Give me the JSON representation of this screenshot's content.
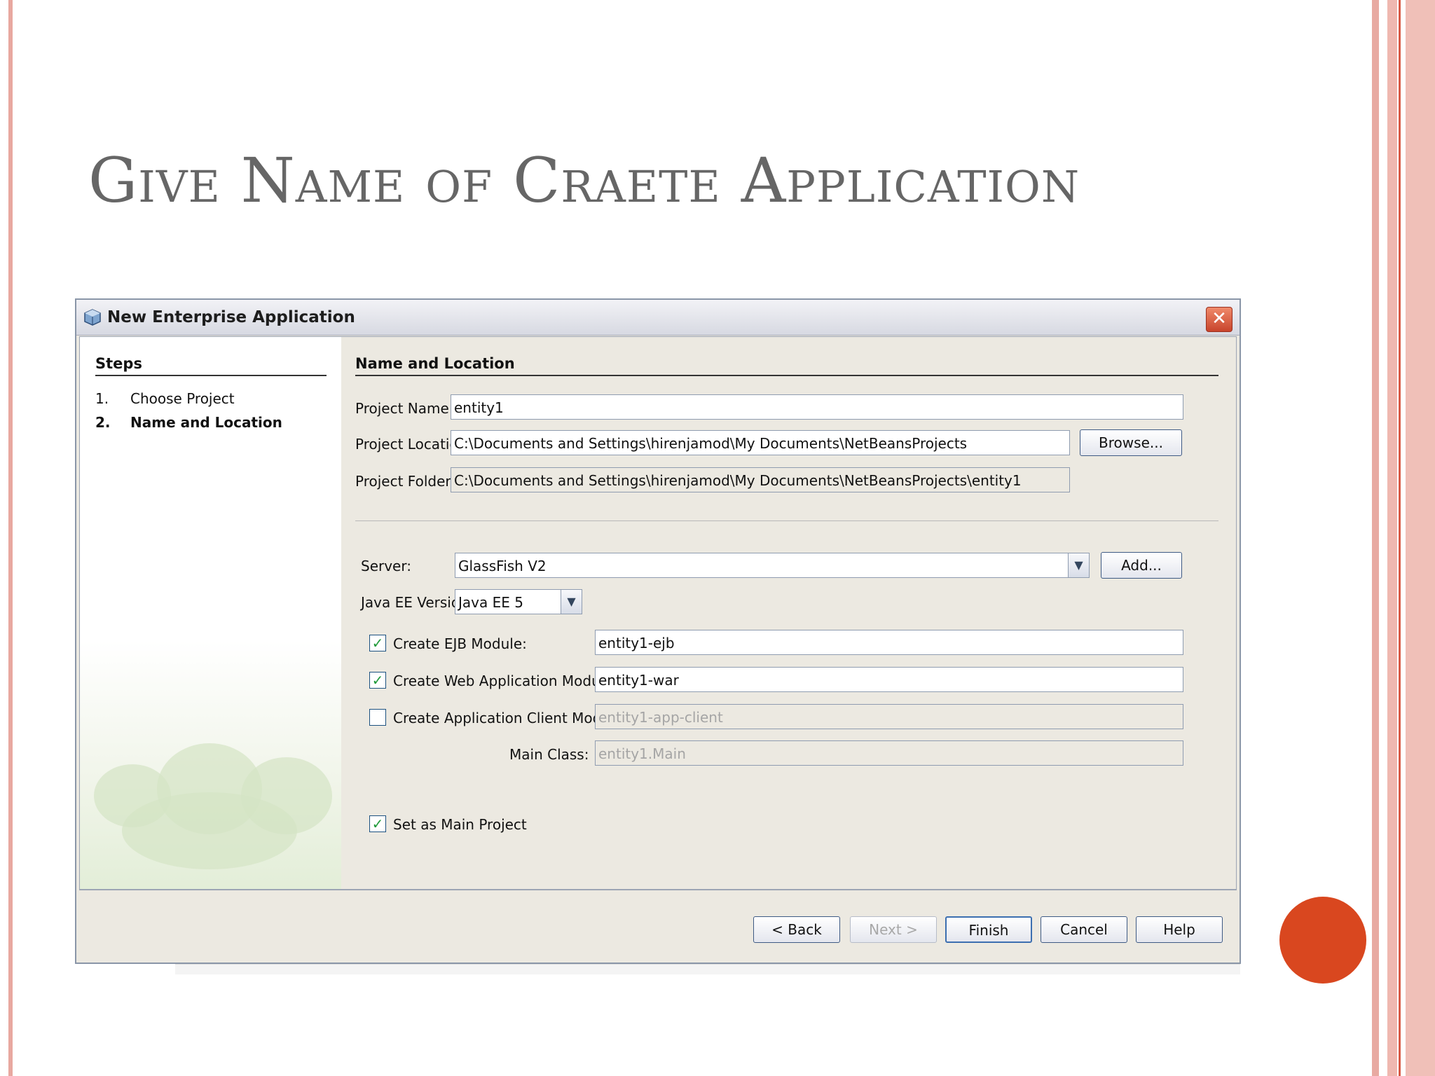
{
  "slide": {
    "title": "Give Name of Craete Application",
    "accent_color": "#d9471f"
  },
  "dialog": {
    "title": "New Enterprise Application",
    "close_icon": "close-icon",
    "steps": {
      "title": "Steps",
      "items": [
        {
          "num": "1.",
          "label": "Choose Project"
        },
        {
          "num": "2.",
          "label": "Name and Location"
        }
      ]
    },
    "section_title": "Name and Location",
    "project_name_label": "Project Name:",
    "project_name_value": "entity1",
    "project_location_label": "Project Location:",
    "project_location_value": "C:\\Documents and Settings\\hirenjamod\\My Documents\\NetBeansProjects",
    "browse_label": "Browse...",
    "project_folder_label": "Project Folder:",
    "project_folder_value": "C:\\Documents and Settings\\hirenjamod\\My Documents\\NetBeansProjects\\entity1",
    "server_label": "Server:",
    "server_value": "GlassFish V2",
    "add_label": "Add...",
    "javaee_label": "Java EE Version:",
    "javaee_value": "Java EE 5",
    "ejb_label": "Create EJB Module:",
    "ejb_value": "entity1-ejb",
    "ejb_checked": true,
    "web_label": "Create Web Application Module:",
    "web_value": "entity1-war",
    "web_checked": true,
    "client_label": "Create Application Client Module:",
    "client_value": "entity1-app-client",
    "client_checked": false,
    "main_class_label": "Main Class:",
    "main_class_value": "entity1.Main",
    "main_project_label": "Set as Main Project",
    "main_project_checked": true,
    "buttons": {
      "back": "< Back",
      "next": "Next >",
      "finish": "Finish",
      "cancel": "Cancel",
      "help": "Help"
    }
  }
}
